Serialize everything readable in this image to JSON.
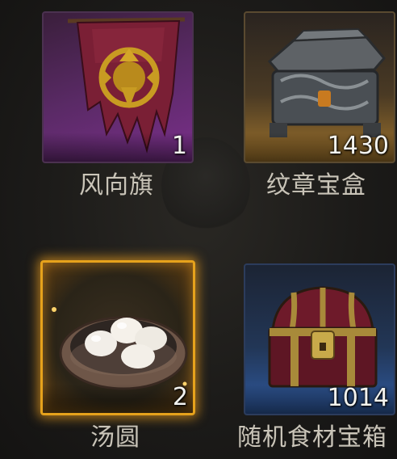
{
  "items": [
    {
      "name": "风向旗",
      "count": "1",
      "rarity_color": "#7a2f8a",
      "icon": "banner-icon"
    },
    {
      "name": "纹章宝盒",
      "count": "1430",
      "rarity_color": "#a0742c",
      "icon": "ornate-chest-icon"
    },
    {
      "name": "汤圆",
      "count": "2",
      "rarity_color": "#e6a21c",
      "icon": "tangyuan-bowl-icon"
    },
    {
      "name": "随机食材宝箱",
      "count": "1014",
      "rarity_color": "#2f5aa0",
      "icon": "treasure-chest-icon"
    }
  ]
}
